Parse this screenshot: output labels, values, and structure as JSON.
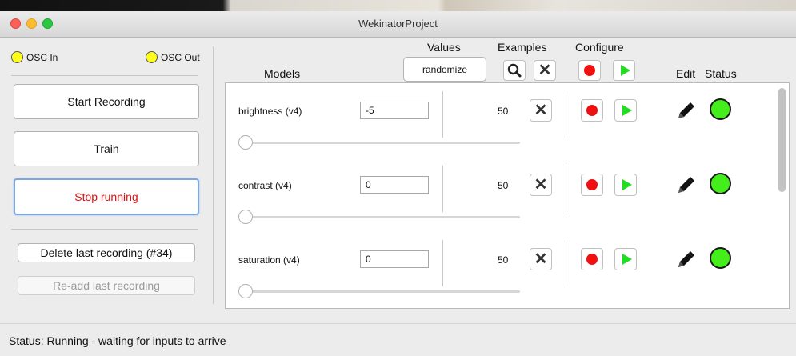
{
  "window": {
    "title": "WekinatorProject"
  },
  "osc": {
    "in_label": "OSC In",
    "out_label": "OSC Out"
  },
  "left": {
    "start_recording": "Start Recording",
    "train": "Train",
    "stop_running": "Stop running",
    "delete_last": "Delete last recording (#34)",
    "readd_last": "Re-add last recording"
  },
  "headers": {
    "models": "Models",
    "values": "Values",
    "randomize": "randomize",
    "examples": "Examples",
    "configure": "Configure",
    "edit": "Edit",
    "status": "Status"
  },
  "models": [
    {
      "name": "brightness (v4)",
      "value": "-5",
      "examples": "50",
      "slider": 0
    },
    {
      "name": "contrast (v4)",
      "value": "0",
      "examples": "50",
      "slider": 0
    },
    {
      "name": "saturation (v4)",
      "value": "0",
      "examples": "50",
      "slider": 0
    }
  ],
  "status_bar": "Status:  Running - waiting for inputs to arrive",
  "colors": {
    "record": "#f01010",
    "play": "#22dd22",
    "status_ok": "#44ee1a",
    "led": "#ffff1a",
    "active_text": "#e01010"
  },
  "icons": [
    "search-icon",
    "close-icon",
    "record-icon",
    "play-icon",
    "pencil-icon"
  ]
}
